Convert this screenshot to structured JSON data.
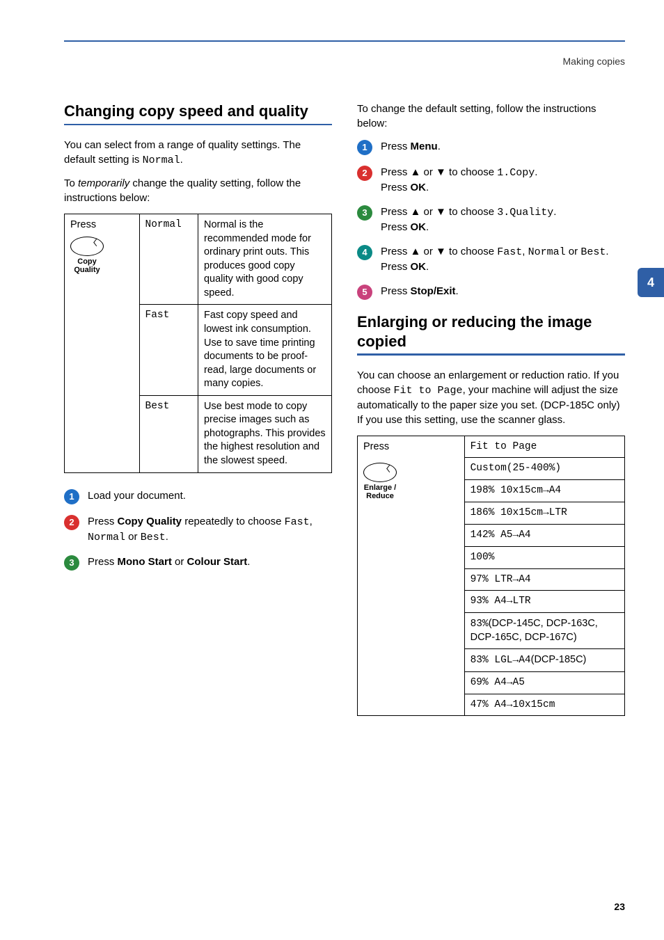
{
  "header": {
    "category": "Making copies"
  },
  "sideTab": "4",
  "pageNumber": "23",
  "left": {
    "heading": "Changing copy speed and quality",
    "intro1_a": "You can select from a range of quality settings. The default setting is ",
    "intro1_mono": "Normal",
    "intro1_b": ".",
    "intro2_a": "To ",
    "intro2_em": "temporarily",
    "intro2_b": " change the quality setting, follow the instructions below:",
    "table": {
      "pressLabel": "Press",
      "iconLabel1": "Copy",
      "iconLabel2": "Quality",
      "rows": [
        {
          "option": "Normal",
          "desc": "Normal is the recommended mode for ordinary print outs. This produces good copy quality with good copy speed."
        },
        {
          "option": "Fast",
          "desc": "Fast copy speed and lowest ink consumption. Use to save time printing documents to be proof-read, large documents or many copies."
        },
        {
          "option": "Best",
          "desc": "Use best mode to copy precise images such as photographs. This provides the highest resolution and the slowest speed."
        }
      ]
    },
    "steps": [
      {
        "num": "1",
        "color": "b-blue",
        "plain": "Load your document."
      },
      {
        "num": "2",
        "color": "b-red",
        "html_a": "Press ",
        "bold1": "Copy Quality",
        "html_b": " repeatedly to choose ",
        "mono1": "Fast",
        "html_c": ", ",
        "mono2": "Normal",
        "html_d": " or ",
        "mono3": "Best",
        "html_e": "."
      },
      {
        "num": "3",
        "color": "b-green",
        "html_a": "Press ",
        "bold1": "Mono Start",
        "html_b": " or ",
        "bold2": "Colour Start",
        "html_c": "."
      }
    ]
  },
  "right": {
    "intro": "To change the default setting, follow the instructions below:",
    "steps": [
      {
        "num": "1",
        "color": "b-blue",
        "a": "Press ",
        "bold1": "Menu",
        "b": "."
      },
      {
        "num": "2",
        "color": "b-red",
        "a": "Press ▲ or ▼ to choose ",
        "mono1": "1.Copy",
        "b": ".",
        "br": true,
        "c": "Press ",
        "bold1": "OK",
        "d": "."
      },
      {
        "num": "3",
        "color": "b-green",
        "a": "Press ▲ or ▼ to choose ",
        "mono1": "3.Quality",
        "b": ".",
        "br": true,
        "c": "Press ",
        "bold1": "OK",
        "d": "."
      },
      {
        "num": "4",
        "color": "b-teal",
        "a": "Press ▲ or ▼ to choose ",
        "mono1": "Fast",
        "b": ", ",
        "mono2": "Normal",
        "c": " or ",
        "mono3": "Best",
        "d": ".",
        "br": true,
        "e": "Press ",
        "bold1": "OK",
        "f": "."
      },
      {
        "num": "5",
        "color": "b-pink",
        "a": "Press ",
        "bold1": "Stop/Exit",
        "b": "."
      }
    ],
    "heading2": "Enlarging or reducing the image copied",
    "para2_a": "You can choose an enlargement or reduction ratio. If you choose ",
    "para2_mono": "Fit to Page",
    "para2_b": ", your machine will adjust the size automatically to the paper size you set. (DCP-185C only) If you use this setting, use the scanner glass.",
    "rtable": {
      "pressLabel": "Press",
      "iconLabel1": "Enlarge /",
      "iconLabel2": "Reduce",
      "rows": [
        {
          "text": "Fit to Page"
        },
        {
          "text": "Custom(25-400%)"
        },
        {
          "text": "198% 10x15cm→A4",
          "arrow": true
        },
        {
          "text": "186% 10x15cm→LTR",
          "arrow": true
        },
        {
          "text": "142% A5→A4",
          "arrow": true
        },
        {
          "text": "100%"
        },
        {
          "text": "97% LTR→A4",
          "arrow": true
        },
        {
          "text": "93% A4→LTR",
          "arrow": true
        },
        {
          "pre": "83%",
          "plain": "(DCP-145C, DCP-163C, DCP-165C, DCP-167C)"
        },
        {
          "pre": "83% LGL→A4",
          "arrow": true,
          "plain": "(DCP-185C)"
        },
        {
          "text": "69% A4→A5",
          "arrow": true
        },
        {
          "text": "47% A4→10x15cm",
          "arrow": true
        }
      ]
    }
  }
}
